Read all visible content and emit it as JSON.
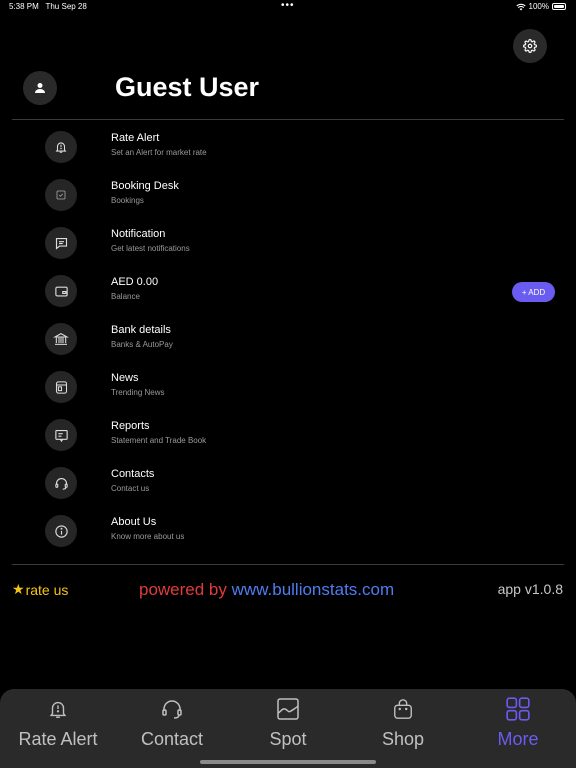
{
  "status_bar": {
    "time": "5:38 PM",
    "date": "Thu Sep 28",
    "dots": "•••",
    "battery": "100%"
  },
  "user": {
    "name": "Guest User"
  },
  "menu": [
    {
      "title": "Rate Alert",
      "subtitle": "Set an Alert for market rate",
      "icon": "bell-icon"
    },
    {
      "title": "Booking Desk",
      "subtitle": "Bookings",
      "icon": "checkbox-icon"
    },
    {
      "title": "Notification",
      "subtitle": "Get latest notifications",
      "icon": "message-icon"
    },
    {
      "title": "AED 0.00",
      "subtitle": "Balance",
      "icon": "wallet-icon"
    },
    {
      "title": "Bank details",
      "subtitle": "Banks & AutoPay",
      "icon": "bank-icon"
    },
    {
      "title": "News",
      "subtitle": "Trending News",
      "icon": "newspaper-icon"
    },
    {
      "title": "Reports",
      "subtitle": "Statement and Trade Book",
      "icon": "report-icon"
    },
    {
      "title": "Contacts",
      "subtitle": "Contact us",
      "icon": "headset-icon"
    },
    {
      "title": "About Us",
      "subtitle": "Know more about us",
      "icon": "info-icon"
    }
  ],
  "add_button": "+ ADD",
  "footer": {
    "rate_us_star": "★",
    "rate_us": "rate us",
    "powered_by": "powered by",
    "link": "www.bullionstats.com",
    "version": "app v1.0.8"
  },
  "tabs": [
    {
      "label": "Rate Alert",
      "icon": "bell-icon",
      "active": false
    },
    {
      "label": "Contact",
      "icon": "headset-icon",
      "active": false
    },
    {
      "label": "Spot",
      "icon": "chart-icon",
      "active": false
    },
    {
      "label": "Shop",
      "icon": "bag-icon",
      "active": false
    },
    {
      "label": "More",
      "icon": "grid-icon",
      "active": true
    }
  ],
  "colors": {
    "accent": "#6a5cf0",
    "background": "#000000",
    "tab_bar": "#2a2a2a",
    "star": "#f5c518",
    "powered_red": "#e03c3c",
    "link_blue": "#4f7df0"
  }
}
